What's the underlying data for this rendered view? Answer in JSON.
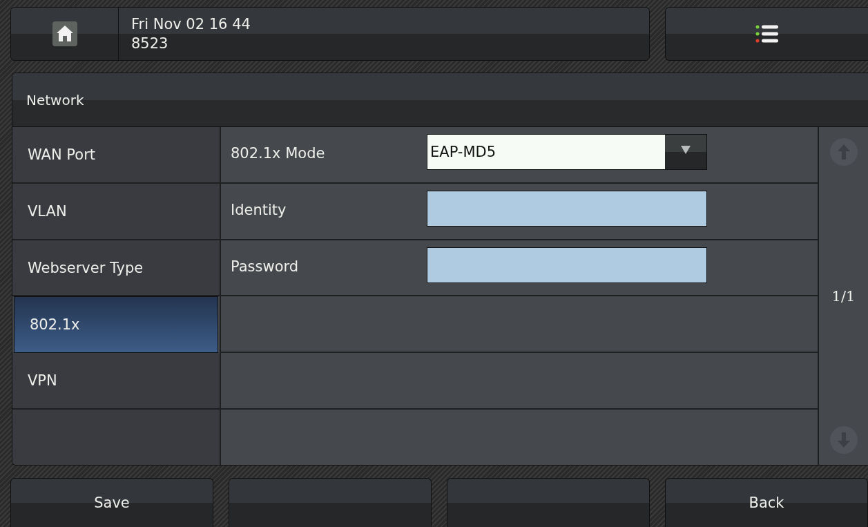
{
  "status_bar": {
    "date": "Fri Nov 02 16 44",
    "extension": "8523"
  },
  "title": "Network",
  "sidebar": {
    "items": [
      {
        "label": "WAN Port",
        "selected": false
      },
      {
        "label": "VLAN",
        "selected": false
      },
      {
        "label": "Webserver Type",
        "selected": false
      },
      {
        "label": "802.1x",
        "selected": true
      },
      {
        "label": "VPN",
        "selected": false
      }
    ]
  },
  "settings": [
    {
      "kind": "dropdown",
      "label": "802.1x Mode",
      "value": "EAP-MD5"
    },
    {
      "kind": "input",
      "label": "Identity"
    },
    {
      "kind": "input",
      "label": "Password"
    }
  ],
  "pager": "1/1",
  "softkeys": [
    {
      "kind": "button",
      "label": "Save"
    },
    {
      "kind": "empty"
    },
    {
      "kind": "empty"
    },
    {
      "kind": "button",
      "label": "Back"
    }
  ]
}
